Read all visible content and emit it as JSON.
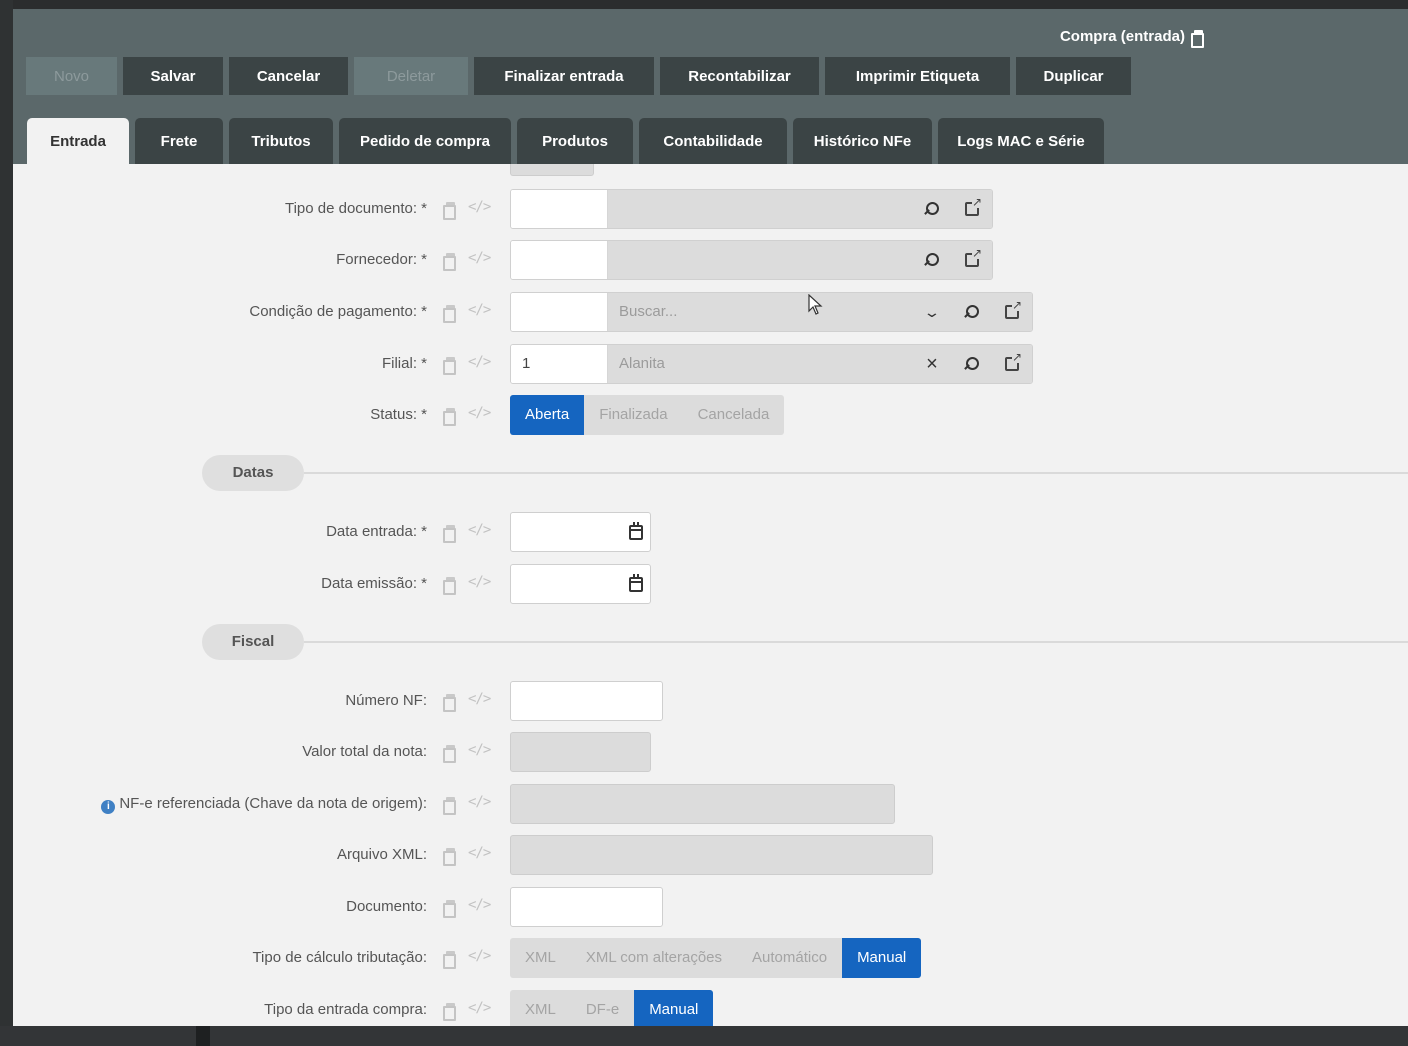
{
  "window": {
    "title": "Compra (entrada)"
  },
  "toolbar": {
    "buttons": [
      {
        "label": "Novo",
        "disabled": true
      },
      {
        "label": "Salvar",
        "disabled": false
      },
      {
        "label": "Cancelar",
        "disabled": false
      },
      {
        "label": "Deletar",
        "disabled": true
      },
      {
        "label": "Finalizar entrada",
        "disabled": false
      },
      {
        "label": "Recontabilizar",
        "disabled": false
      },
      {
        "label": "Imprimir Etiqueta",
        "disabled": false
      },
      {
        "label": "Duplicar",
        "disabled": false
      }
    ]
  },
  "tabs": [
    {
      "label": "Entrada",
      "active": true
    },
    {
      "label": "Frete"
    },
    {
      "label": "Tributos"
    },
    {
      "label": "Pedido de compra"
    },
    {
      "label": "Produtos"
    },
    {
      "label": "Contabilidade"
    },
    {
      "label": "Histórico NFe"
    },
    {
      "label": "Logs MAC e Série"
    }
  ],
  "form": {
    "tipo_documento": {
      "label": "Tipo de documento: *",
      "code": "",
      "desc": ""
    },
    "fornecedor": {
      "label": "Fornecedor: *",
      "code": "",
      "desc": ""
    },
    "condicao_pagamento": {
      "label": "Condição de pagamento: *",
      "code": "",
      "placeholder": "Buscar..."
    },
    "filial": {
      "label": "Filial: *",
      "code": "1",
      "desc": "Alanita"
    },
    "status": {
      "label": "Status: *",
      "options": [
        "Aberta",
        "Finalizada",
        "Cancelada"
      ],
      "selected": "Aberta"
    },
    "sections": {
      "datas": "Datas",
      "fiscal": "Fiscal"
    },
    "data_entrada": {
      "label": "Data entrada: *",
      "value": ""
    },
    "data_emissao": {
      "label": "Data emissão: *",
      "value": ""
    },
    "numero_nf": {
      "label": "Número NF:",
      "value": ""
    },
    "valor_total": {
      "label": "Valor total da nota:",
      "value": ""
    },
    "nfe_referenciada": {
      "label": "NF-e referenciada (Chave da nota de origem):",
      "info_icon": "i",
      "value": ""
    },
    "arquivo_xml": {
      "label": "Arquivo XML:",
      "value": ""
    },
    "documento": {
      "label": "Documento:",
      "value": ""
    },
    "tipo_calculo": {
      "label": "Tipo de cálculo tributação:",
      "options": [
        "XML",
        "XML com alterações",
        "Automático",
        "Manual"
      ],
      "selected": "Manual"
    },
    "tipo_entrada": {
      "label": "Tipo da entrada compra:",
      "options": [
        "XML",
        "DF-e",
        "Manual"
      ],
      "selected": "Manual"
    }
  },
  "icons": {
    "copy": "copy-icon",
    "code": "</>",
    "search": "search-icon",
    "external": "external-link-icon",
    "clear": "×",
    "dropdown": "chevron-down-icon",
    "calendar": "calendar-icon"
  },
  "colors": {
    "header": "#5b686a",
    "button": "#3b4445",
    "selected": "#1565c0",
    "info": "#3f80c4"
  }
}
